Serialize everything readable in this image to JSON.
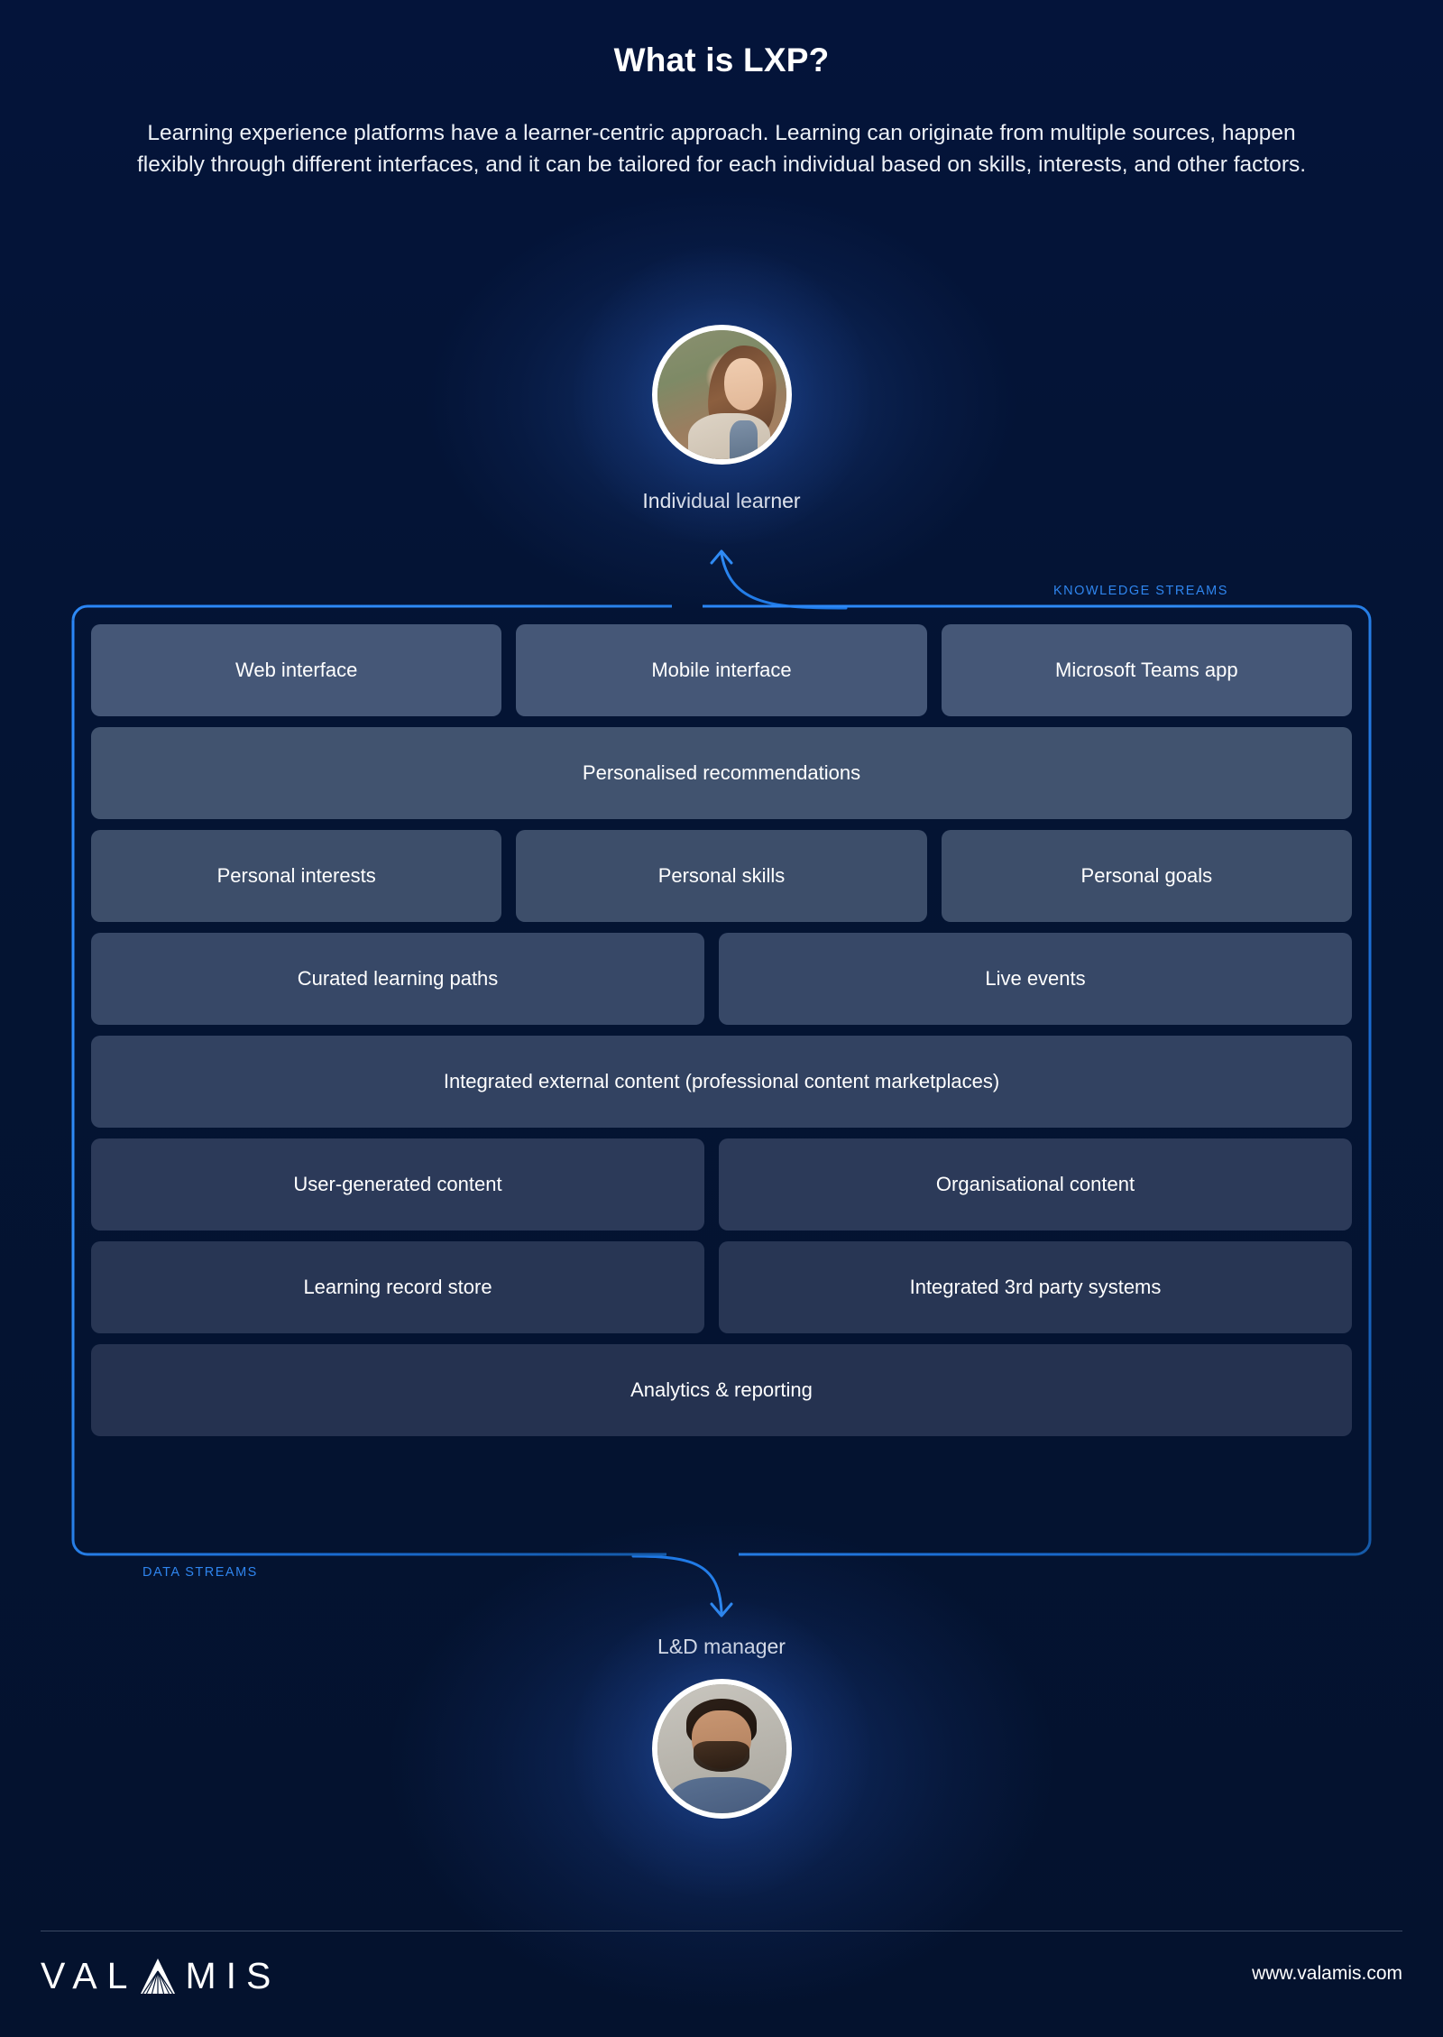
{
  "header": {
    "title": "What is LXP?",
    "subtitle": "Learning experience platforms have a learner-centric approach. Learning can originate from multiple sources, happen flexibly through different interfaces, and it can be tailored for each individual based on skills, interests, and other factors."
  },
  "personas": {
    "learner": {
      "label": "Individual learner",
      "avatar": "woman-portrait-avatar"
    },
    "manager": {
      "label": "L&D manager",
      "avatar": "man-portrait-avatar"
    }
  },
  "streams": {
    "knowledge_label": "KNOWLEDGE STREAMS",
    "data_label": "DATA STREAMS"
  },
  "diagram": {
    "rows": [
      {
        "tone": "t1",
        "boxes": [
          {
            "label": "Web interface"
          },
          {
            "label": "Mobile interface"
          },
          {
            "label": "Microsoft Teams app"
          }
        ]
      },
      {
        "tone": "t2",
        "boxes": [
          {
            "label": "Personalised recommendations"
          }
        ]
      },
      {
        "tone": "t3",
        "boxes": [
          {
            "label": "Personal interests"
          },
          {
            "label": "Personal skills"
          },
          {
            "label": "Personal goals"
          }
        ]
      },
      {
        "tone": "t4",
        "boxes": [
          {
            "label": "Curated learning paths",
            "span": "wide-l"
          },
          {
            "label": "Live events",
            "span": "wide-r"
          }
        ]
      },
      {
        "tone": "t5",
        "boxes": [
          {
            "label": "Integrated external content (professional content marketplaces)"
          }
        ]
      },
      {
        "tone": "t6",
        "boxes": [
          {
            "label": "User-generated content",
            "span": "wide-l"
          },
          {
            "label": "Organisational content",
            "span": "wide-r"
          }
        ]
      },
      {
        "tone": "t7",
        "boxes": [
          {
            "label": "Learning record store",
            "span": "wide-l"
          },
          {
            "label": "Integrated 3rd party systems",
            "span": "wide-r"
          }
        ]
      },
      {
        "tone": "t8",
        "boxes": [
          {
            "label": "Analytics & reporting"
          }
        ]
      }
    ]
  },
  "footer": {
    "logo_text": "VALAMIS",
    "logo_part_1": "VAL",
    "logo_part_2": "MIS",
    "url": "www.valamis.com"
  },
  "colors": {
    "background": "#041430",
    "accent_blue": "#2f85ee",
    "border_blue": "#1d76e8",
    "text_white": "#ffffff",
    "box_top": "#455777",
    "box_bottom": "#253250",
    "footer_rule": "#3c4a64"
  }
}
